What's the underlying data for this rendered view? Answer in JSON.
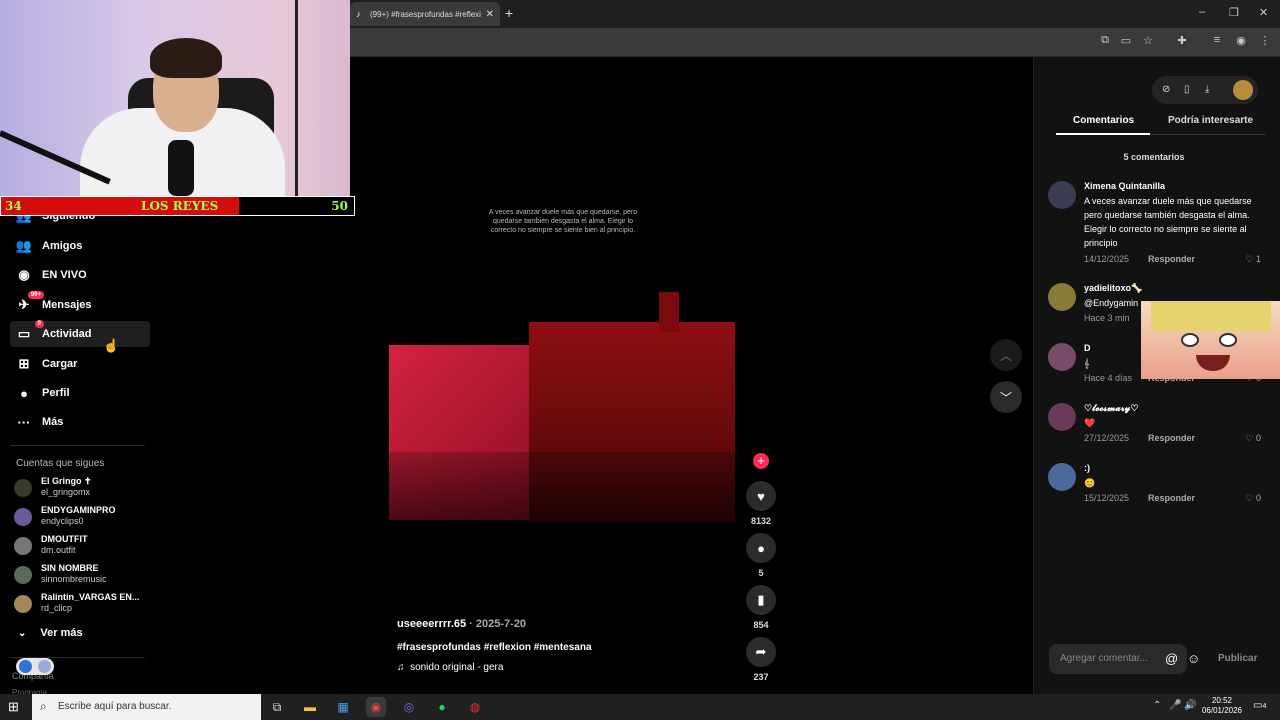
{
  "browser": {
    "tab_title": "(99+) #frasesprofundas #reflexi",
    "tab_close": "✕",
    "new_tab": "+",
    "window_controls": [
      "–",
      "❐",
      "✕"
    ]
  },
  "overlay": {
    "score_left": "34",
    "score_title": "LOS REYES",
    "score_right": "50"
  },
  "sidebar": {
    "items": [
      {
        "label": "Siguiendo",
        "icon": "following-icon",
        "glyph": "👥"
      },
      {
        "label": "Amigos",
        "icon": "friends-icon",
        "glyph": "👥"
      },
      {
        "label": "EN VIVO",
        "icon": "live-icon",
        "glyph": "◉"
      },
      {
        "label": "Mensajes",
        "icon": "messages-icon",
        "glyph": "✈",
        "badge": "99+"
      },
      {
        "label": "Actividad",
        "icon": "activity-icon",
        "glyph": "▭",
        "badge": "9"
      },
      {
        "label": "Cargar",
        "icon": "upload-icon",
        "glyph": "⊞"
      },
      {
        "label": "Perfil",
        "icon": "profile-icon",
        "glyph": "●"
      },
      {
        "label": "Más",
        "icon": "more-icon",
        "glyph": "···"
      }
    ],
    "following_heading": "Cuentas que sigues",
    "accounts": [
      {
        "name": "El Gringo ✝",
        "handle": "el_gringomx"
      },
      {
        "name": "ENDYGAMINPRO",
        "handle": "endyclips0"
      },
      {
        "name": "DMOUTFIT",
        "handle": "dm.outfit"
      },
      {
        "name": "SIN NOMBRE",
        "handle": "sinnombremusic"
      },
      {
        "name": "Ralintin_VARGAS EN...",
        "handle": "rd_clicp"
      }
    ],
    "see_more": "Ver más",
    "footer_company": "Compañía",
    "footer_program": "Programa"
  },
  "video": {
    "caption": "A veces avanzar duele más que quedarse, pero quedarse también desgasta el alma. Elegir lo correcto no siempre se siente bien al principio.",
    "author": "useeeerrrr.65",
    "date": " · 2025-7-20",
    "hashtags": "#frasesprofundas #reflexion #mentesana",
    "sound": "sonido original - gera",
    "sound_icon": "♫"
  },
  "actions": {
    "likes": "8132",
    "comments": "5",
    "saves": "854",
    "shares": "237"
  },
  "panel": {
    "tab_comments": "Comentarios",
    "tab_interest": "Podría interesarte",
    "comment_count": "5 comentarios",
    "reply_label": "Responder",
    "comments": [
      {
        "name": "Ximena Quintanilla",
        "text": "A veces avanzar duele más que quedarse pero quedarse también desgasta el alma. Elegir lo correcto no siempre se siente al principio",
        "date": "14/12/2025",
        "likes": "1"
      },
      {
        "name": "yadielitoxo🦴",
        "text": "@Endygamin",
        "date": "Hace 3 min",
        "likes": ""
      },
      {
        "name": "D",
        "text": "𝄞",
        "date": "Hace 4 días",
        "likes": "0"
      },
      {
        "name": "♡𝓵𝓮𝓸𝓼𝓶𝓪𝓻𝔂♡",
        "text": "❤️",
        "date": "27/12/2025",
        "likes": "0"
      },
      {
        "name": ":)",
        "text": "😊",
        "date": "15/12/2025",
        "likes": "0"
      }
    ],
    "comment_placeholder": "Agregar comentar...",
    "at_symbol": "@",
    "emoji_symbol": "☺",
    "publish": "Publicar"
  },
  "taskbar": {
    "search_placeholder": "Escribe aquí para buscar.",
    "time": "20:52",
    "date": "06/01/2026",
    "notif_count": "4"
  },
  "colors": {
    "accent": "#fe2c55",
    "score_red": "#d60b0b",
    "score_text": "#9dff4f"
  }
}
